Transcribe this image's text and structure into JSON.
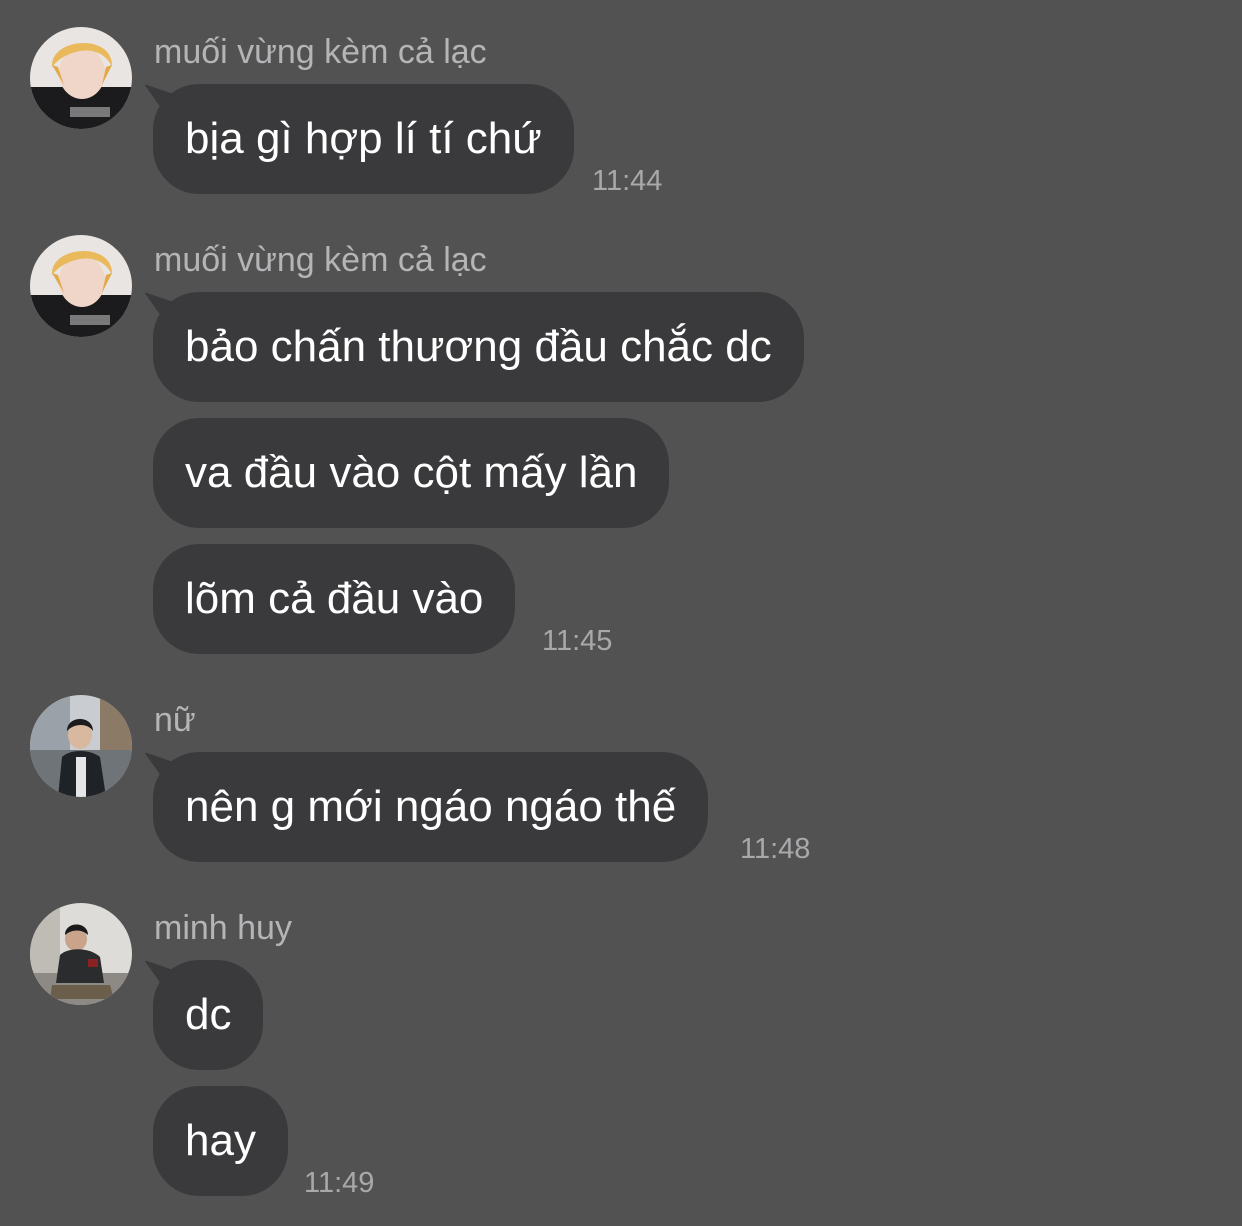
{
  "conversation": {
    "groups": [
      {
        "sender": "muối vừng kèm cả lạc",
        "avatar": "blonde-hair-person-avatar",
        "messages": [
          "bịa gì hợp lí tí chứ"
        ],
        "time": "11:44"
      },
      {
        "sender": "muối vừng kèm cả lạc",
        "avatar": "blonde-hair-person-avatar",
        "messages": [
          "bảo chấn thương đầu chắc dc",
          "va đầu vào cột mấy lần",
          "lõm cả đầu vào"
        ],
        "time": "11:45"
      },
      {
        "sender": "nữ",
        "avatar": "person-by-river-avatar",
        "messages": [
          "nên g mới ngáo ngáo thế"
        ],
        "time": "11:48"
      },
      {
        "sender": "minh huy",
        "avatar": "seated-person-avatar",
        "messages": [
          "dc",
          "hay"
        ],
        "time": "11:49"
      }
    ]
  },
  "colors": {
    "background": "#535253",
    "bubble": "#3a393b",
    "message_text": "#ffffff",
    "sender_text": "#b5b4b6",
    "time_text": "#a9a8aa"
  }
}
